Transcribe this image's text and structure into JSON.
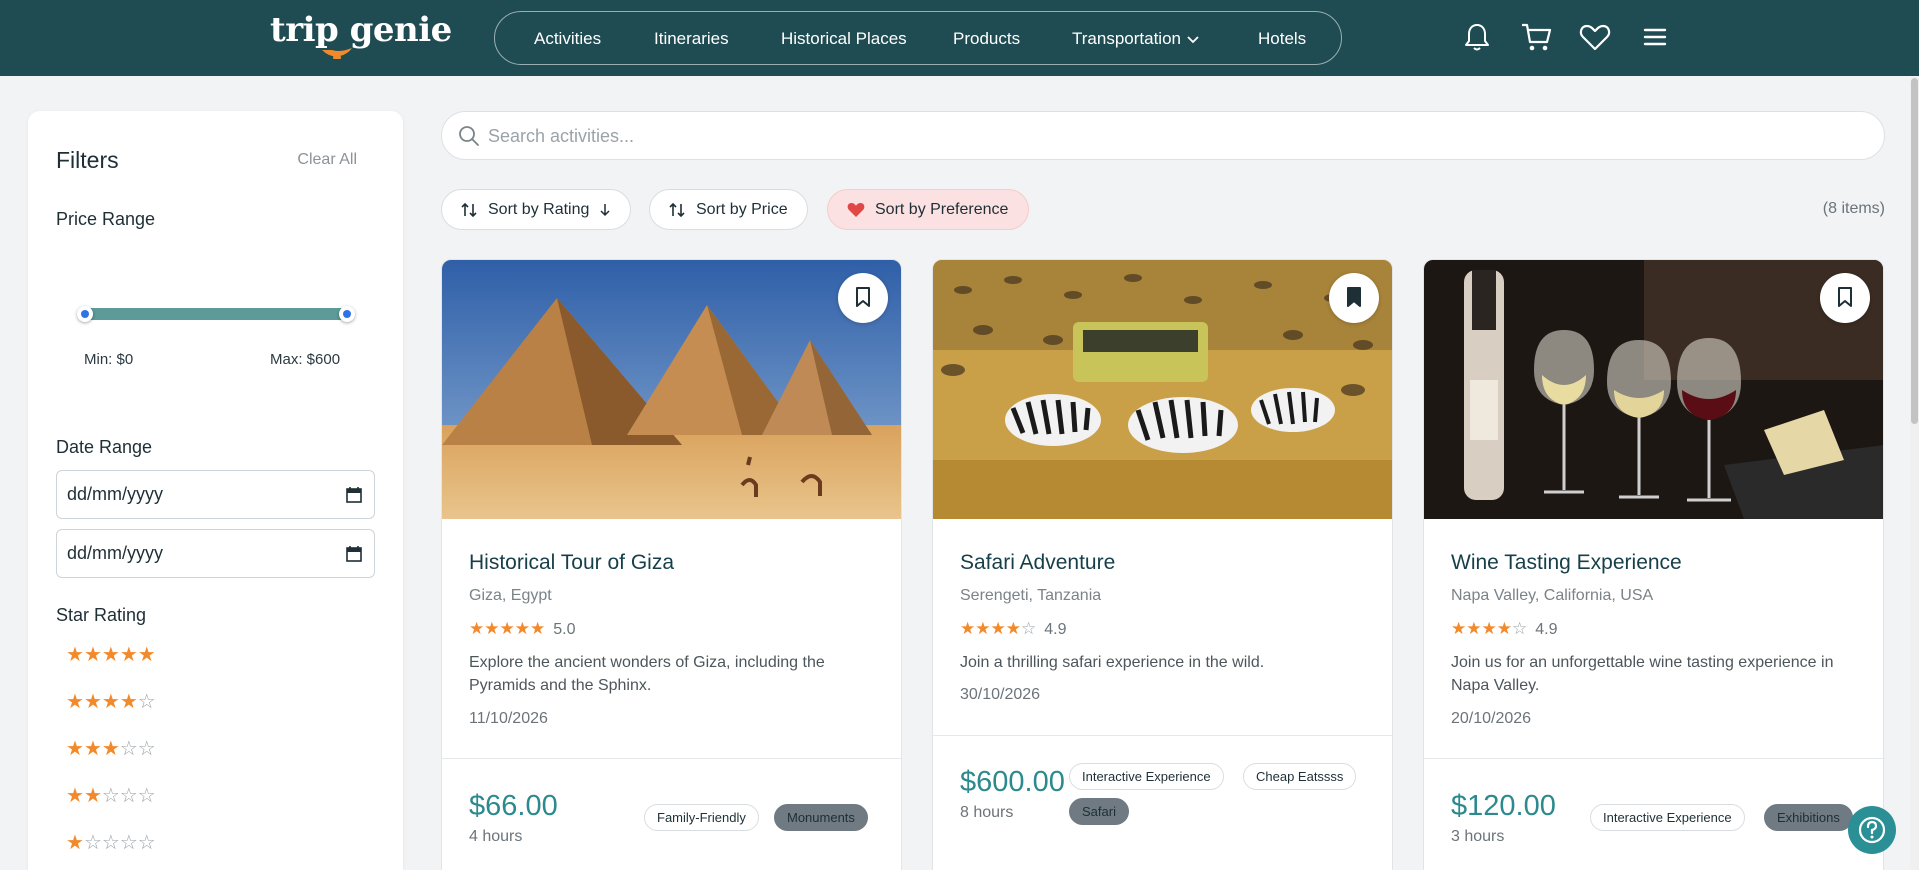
{
  "header": {
    "logo_text": "trip genie",
    "nav": [
      "Activities",
      "Itineraries",
      "Historical Places",
      "Products",
      "Transportation",
      "Hotels"
    ],
    "icons": [
      "bell-icon",
      "cart-icon",
      "heart-icon",
      "menu-icon"
    ]
  },
  "filters": {
    "title": "Filters",
    "clear_all": "Clear All",
    "price_range_label": "Price Range",
    "price_min_label": "Min: $0",
    "price_max_label": "Max: $600",
    "date_range_label": "Date Range",
    "date_from_placeholder": "dd/mm/yyyy",
    "date_to_placeholder": "dd/mm/yyyy",
    "star_rating_label": "Star Rating",
    "star_options": [
      5,
      4,
      3,
      2,
      1
    ]
  },
  "search": {
    "placeholder": "Search activities..."
  },
  "sort": {
    "rating": "Sort by Rating",
    "price": "Sort by Price",
    "preference": "Sort by Preference"
  },
  "items_count": "(8 items)",
  "cards": [
    {
      "title": "Historical Tour of Giza",
      "location": "Giza, Egypt",
      "stars": 5,
      "rating": "5.0",
      "description": "Explore the ancient wonders of Giza, including the Pyramids and the Sphinx.",
      "date": "11/10/2026",
      "price": "$66.00",
      "duration": "4 hours",
      "tags": [
        "Family-Friendly",
        "Monuments"
      ],
      "bookmarked": false
    },
    {
      "title": "Safari Adventure",
      "location": "Serengeti, Tanzania",
      "stars": 4,
      "rating": "4.9",
      "description": "Join a thrilling safari experience in the wild.",
      "date": "30/10/2026",
      "price": "$600.00",
      "duration": "8 hours",
      "tags": [
        "Interactive Experience",
        "Cheap Eatssss",
        "Safari"
      ],
      "bookmarked": true
    },
    {
      "title": "Wine Tasting Experience",
      "location": "Napa Valley, California, USA",
      "stars": 4,
      "rating": "4.9",
      "description": "Join us for an unforgettable wine tasting experience in Napa Valley.",
      "date": "20/10/2026",
      "price": "$120.00",
      "duration": "3 hours",
      "tags": [
        "Interactive Experience",
        "Exhibitions"
      ],
      "bookmarked": false
    }
  ],
  "colors": {
    "header_bg": "#1f4c52",
    "accent": "#2c8a8f",
    "star": "#f28a2b",
    "slider": "#5c9b98",
    "preference_bg": "#fbe1e1"
  }
}
